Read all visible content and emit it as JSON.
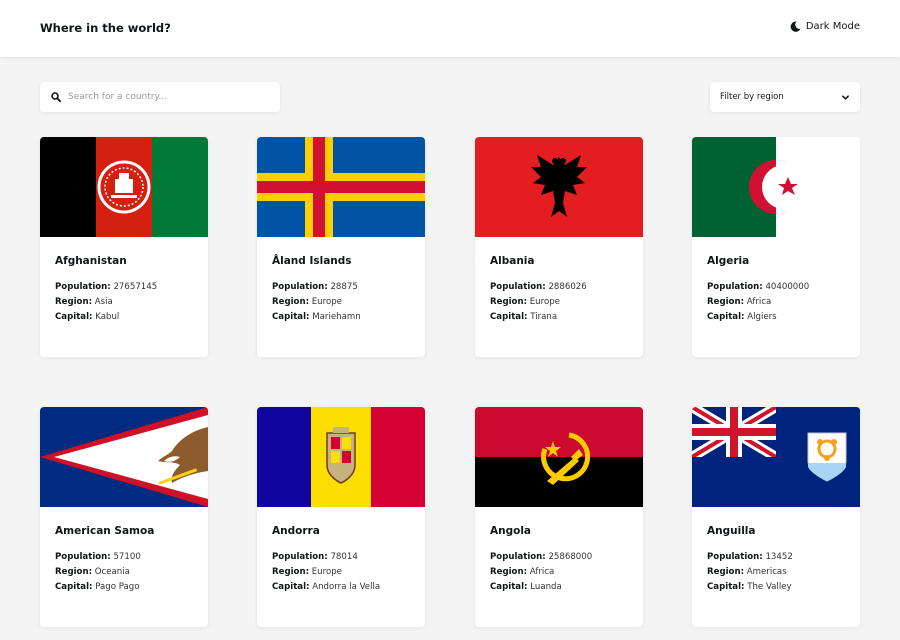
{
  "header": {
    "title": "Where in the world?",
    "dark_mode_label": "Dark Mode",
    "dark_mode_icon": "moon-icon"
  },
  "search": {
    "placeholder": "Search for a country...",
    "value": "",
    "icon": "search-icon"
  },
  "filter": {
    "label": "Filter by region",
    "icon": "chevron-down-icon"
  },
  "labels": {
    "population": "Population:",
    "region": "Region:",
    "capital": "Capital:"
  },
  "countries": [
    {
      "name": "Afghanistan",
      "population": "27657145",
      "region": "Asia",
      "capital": "Kabul"
    },
    {
      "name": "Åland Islands",
      "population": "28875",
      "region": "Europe",
      "capital": "Mariehamn"
    },
    {
      "name": "Albania",
      "population": "2886026",
      "region": "Europe",
      "capital": "Tirana"
    },
    {
      "name": "Algeria",
      "population": "40400000",
      "region": "Africa",
      "capital": "Algiers"
    },
    {
      "name": "American Samoa",
      "population": "57100",
      "region": "Oceania",
      "capital": "Pago Pago"
    },
    {
      "name": "Andorra",
      "population": "78014",
      "region": "Europe",
      "capital": "Andorra la Vella"
    },
    {
      "name": "Angola",
      "population": "25868000",
      "region": "Africa",
      "capital": "Luanda"
    },
    {
      "name": "Anguilla",
      "population": "13452",
      "region": "Americas",
      "capital": "The Valley"
    }
  ]
}
